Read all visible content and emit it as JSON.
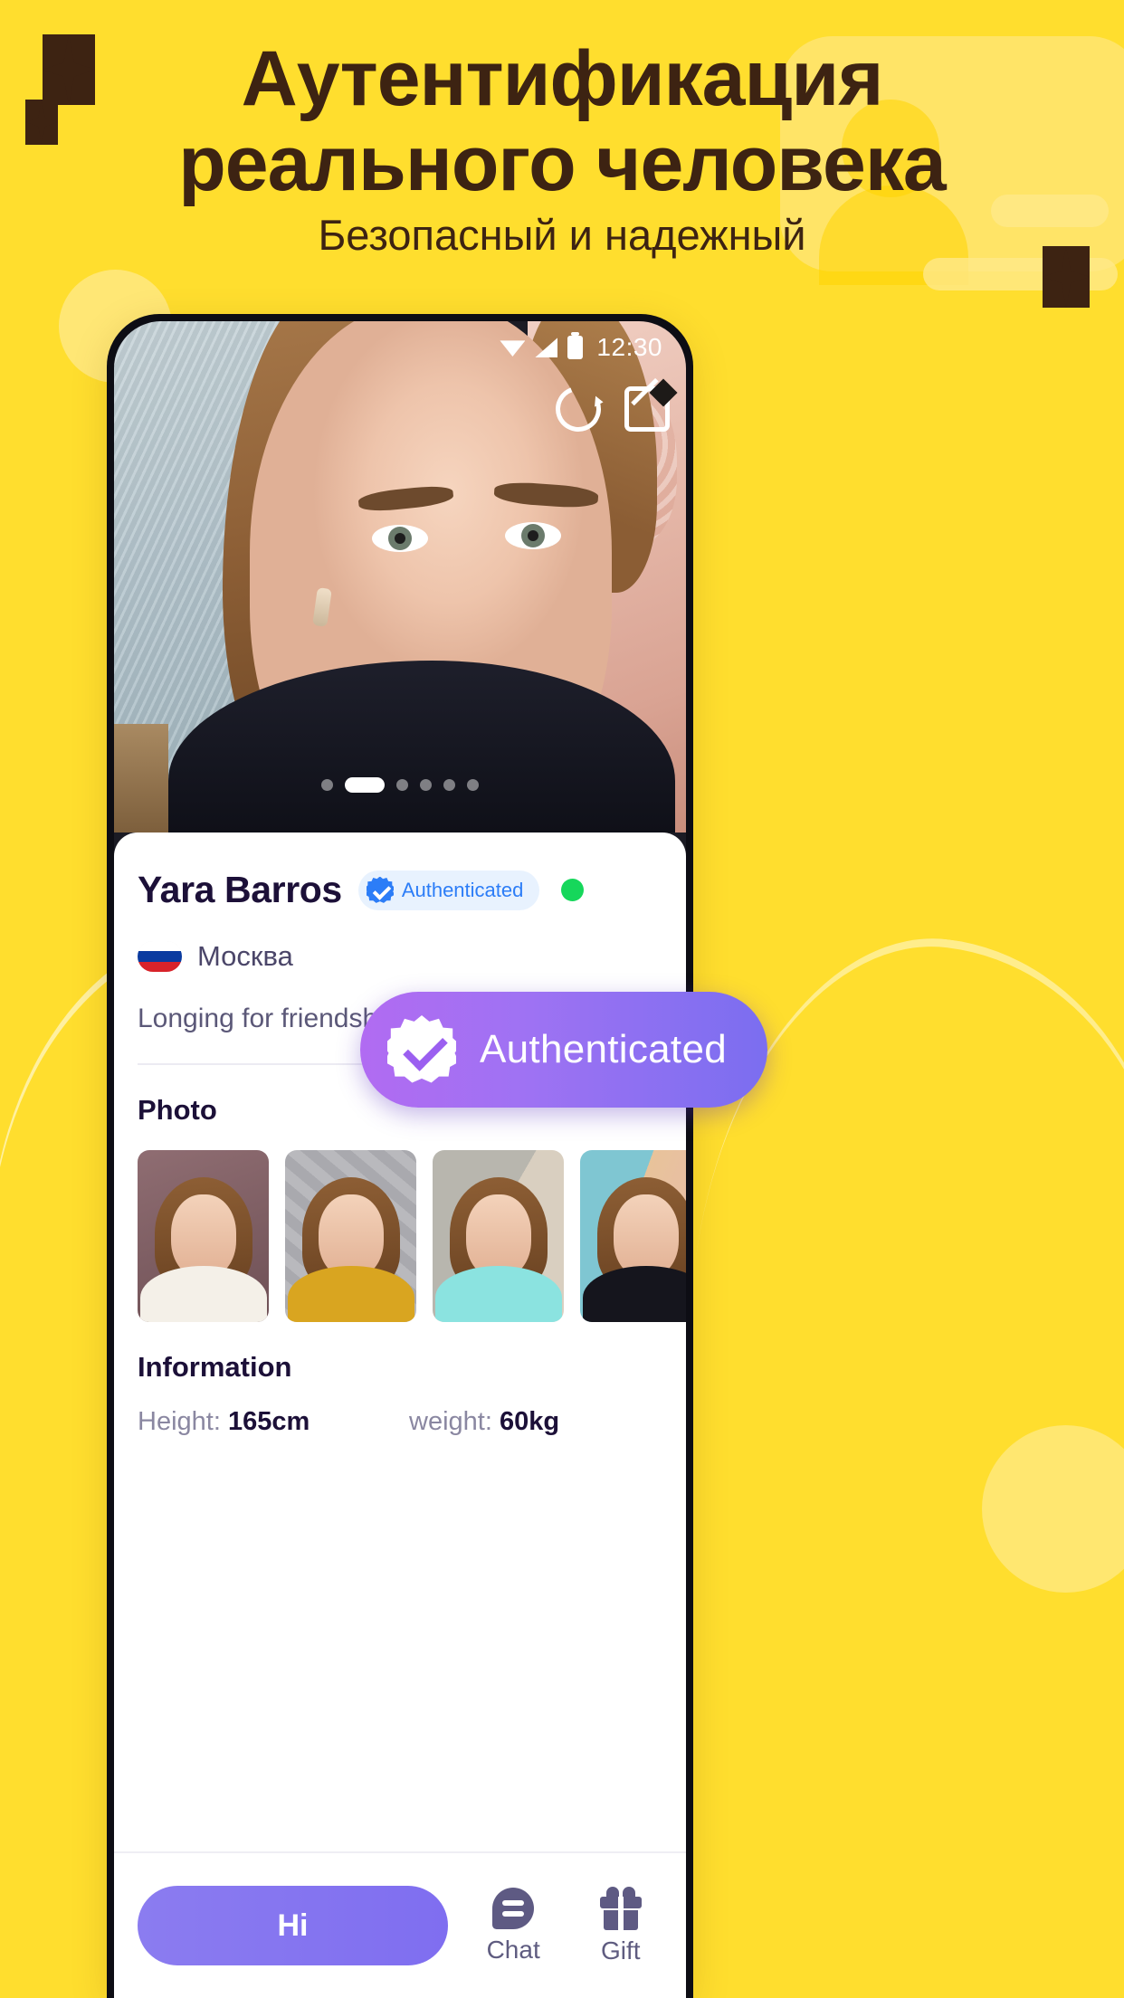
{
  "hero": {
    "headline_line1": "Аутентификация",
    "headline_line2": "реального человека",
    "subtitle": "Безопасный и надежный",
    "colors": {
      "background": "#FFDE2E",
      "headline_text": "#3D2312",
      "accent_purple": "#8B7CF0",
      "badge_blue": "#2C7DF7",
      "online_green": "#16D75B"
    }
  },
  "phone": {
    "statusbar": {
      "time": "12:30",
      "icons": [
        "wifi-icon",
        "signal-icon",
        "battery-icon"
      ]
    },
    "hero_actions": [
      {
        "name": "refresh-icon",
        "label": "refresh"
      },
      {
        "name": "edit-icon",
        "label": "edit"
      }
    ],
    "carousel": {
      "total_dots": 6,
      "active_index": 1
    },
    "floating_badge": {
      "label": "Authenticated",
      "icon": "verified-starburst-icon"
    },
    "profile": {
      "name": "Yara Barros",
      "auth_chip_label": "Authenticated",
      "online_status": "online",
      "location": "Москва",
      "flag": "russia-flag",
      "bio": "Longing for friendship, love and adventure",
      "photo_section_title": "Photo",
      "photos": [
        {
          "alt": "photo-1"
        },
        {
          "alt": "photo-2"
        },
        {
          "alt": "photo-3"
        },
        {
          "alt": "photo-4"
        }
      ],
      "info_section_title": "Information",
      "info": [
        {
          "label": "Height:",
          "value": "165cm"
        },
        {
          "label": "weight:",
          "value": "60kg"
        }
      ]
    },
    "bottombar": {
      "primary_button": "Hi",
      "actions": [
        {
          "label": "Chat",
          "icon": "chat-icon"
        },
        {
          "label": "Gift",
          "icon": "gift-icon"
        }
      ]
    }
  }
}
